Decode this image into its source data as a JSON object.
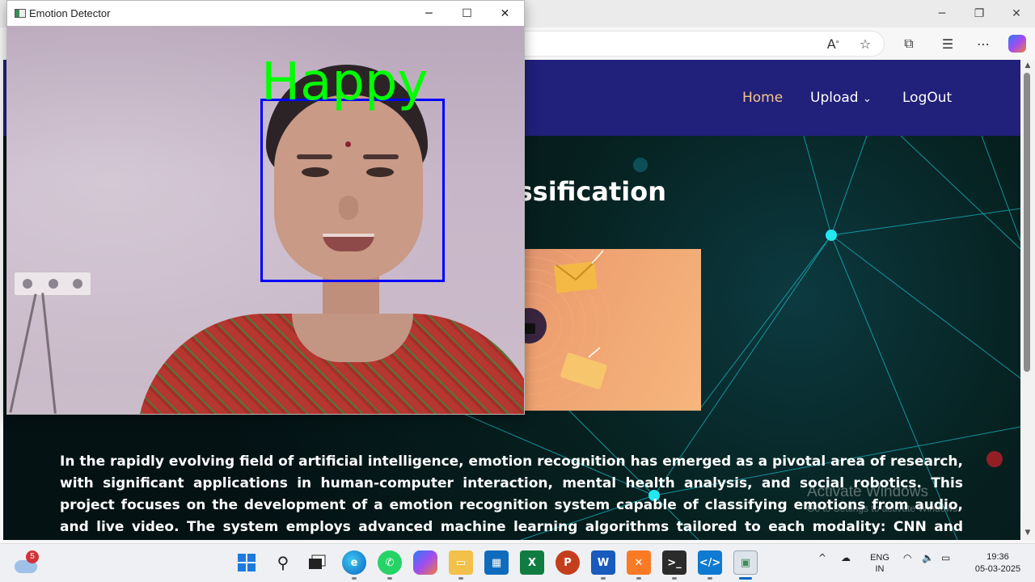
{
  "browser": {
    "window_controls": [
      "─",
      "❐",
      "✕"
    ],
    "toolbar_icons": [
      "read-aloud-icon",
      "favorite-star-icon",
      "extensions-icon",
      "favorites-icon",
      "more-icon",
      "copilot-icon"
    ]
  },
  "site": {
    "nav": {
      "home": "Home",
      "upload": "Upload",
      "logout": "LogOut"
    },
    "hero_title_visible": "ssification",
    "paragraph": "In the rapidly evolving field of artificial intelligence, emotion recognition has emerged as a pivotal area of research, with significant applications in human-computer interaction, mental health analysis, and social robotics. This project focuses on the development of a emotion recognition system capable of classifying emotions from audio, and live video. The system employs advanced machine learning algorithms tailored to each modality: CNN and LSTM for audio, and CNN for live video",
    "watermark": {
      "title": "Activate Windows",
      "subtitle": "Go to Settings to activate Windows."
    }
  },
  "detector": {
    "title": "Emotion Detector",
    "controls": [
      "─",
      "☐",
      "✕"
    ],
    "emotion": "Happy",
    "label_color": "#00ff00",
    "box_color": "#0000ff"
  },
  "taskbar": {
    "weather_badge": "5",
    "apps": [
      "start",
      "search",
      "task-view",
      "edge",
      "whatsapp",
      "copilot",
      "file-explorer",
      "store",
      "excel",
      "powerpoint",
      "word",
      "xampp",
      "terminal",
      "vscode",
      "emotion-detector"
    ],
    "language": {
      "line1": "ENG",
      "line2": "IN"
    },
    "time": "19:36",
    "date": "05-03-2025"
  }
}
